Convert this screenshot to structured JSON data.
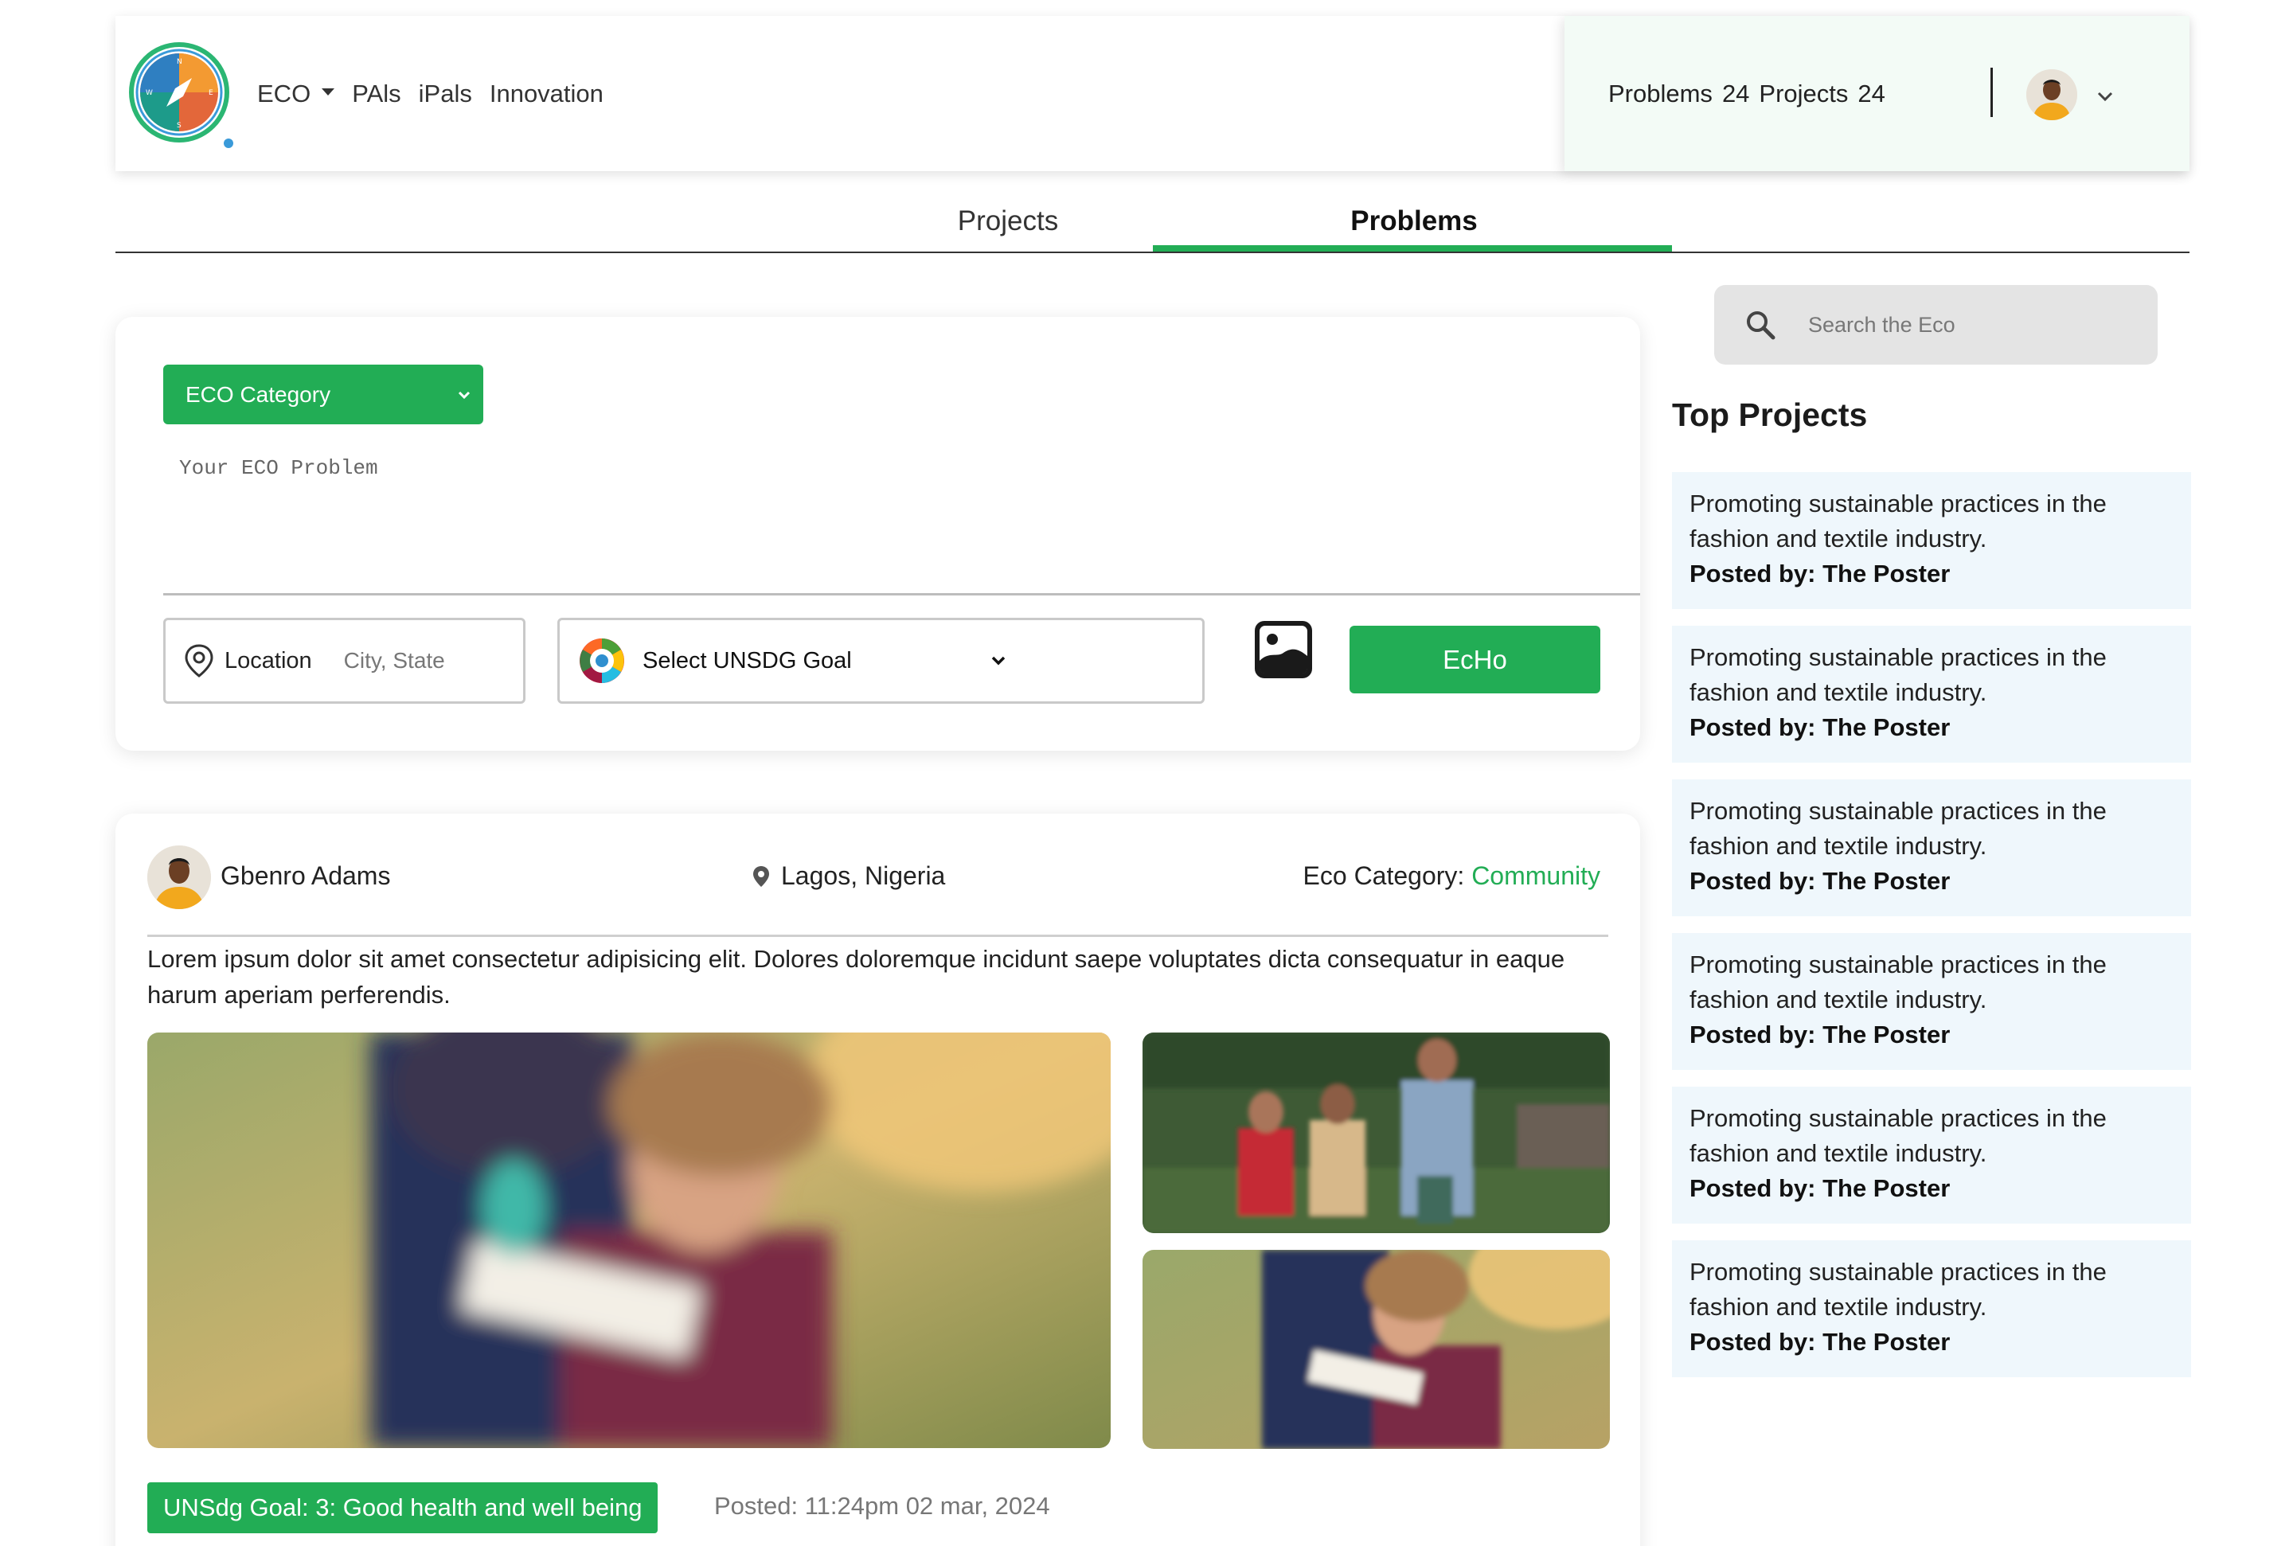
{
  "nav": {
    "items": [
      {
        "label": "ECO",
        "dropdown": true
      },
      {
        "label": "PAls",
        "dropdown": false
      },
      {
        "label": "iPals",
        "dropdown": false
      },
      {
        "label": "Innovation",
        "dropdown": false
      }
    ]
  },
  "stats": {
    "problems_label": "Problems",
    "problems_count": "24",
    "projects_label": "Projects",
    "projects_count": "24"
  },
  "tabs": {
    "projects": "Projects",
    "problems": "Problems",
    "active": "Problems"
  },
  "composer": {
    "category_select": "ECO Category",
    "problem_placeholder": "Your ECO Problem",
    "location_label": "Location",
    "location_placeholder": "City, State",
    "goal_select": "Select UNSDG Goal",
    "submit_label": "EcHo"
  },
  "post": {
    "author": "Gbenro Adams",
    "location": "Lagos, Nigeria",
    "category_label": "Eco Category:",
    "category_value": "Community",
    "body": "Lorem ipsum dolor sit amet consectetur adipisicing elit. Dolores doloremque incidunt saepe voluptates dicta consequatur in eaque harum aperiam perferendis.",
    "goal_badge": "UNSdg Goal: 3: Good health and well being",
    "posted": "Posted: 11:24pm 02 mar, 2024"
  },
  "sidebar": {
    "search_placeholder": "Search the Eco",
    "top_title": "Top Projects",
    "projects": [
      {
        "text": "Promoting sustainable practices in the fashion and textile industry.",
        "by": "Posted by: The Poster"
      },
      {
        "text": "Promoting sustainable practices in the fashion and textile industry.",
        "by": "Posted by: The Poster"
      },
      {
        "text": "Promoting sustainable practices in the fashion and textile industry.",
        "by": "Posted by: The Poster"
      },
      {
        "text": "Promoting sustainable practices in the fashion and textile industry.",
        "by": "Posted by: The Poster"
      },
      {
        "text": "Promoting sustainable practices in the fashion and textile industry.",
        "by": "Posted by: The Poster"
      },
      {
        "text": "Promoting sustainable practices in the fashion and textile industry.",
        "by": "Posted by: The Poster"
      }
    ]
  },
  "colors": {
    "accent": "#22ad55",
    "card_bg": "#eff7fc",
    "stats_bg": "#f3fbf6"
  }
}
